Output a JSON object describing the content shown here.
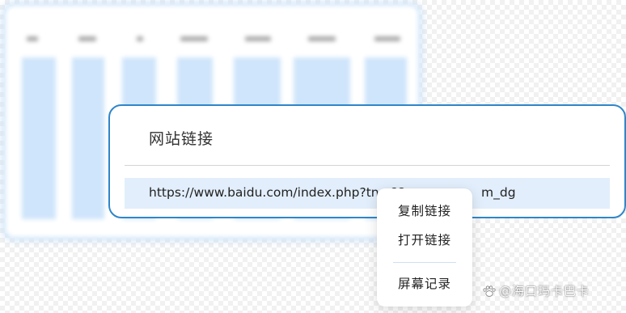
{
  "dialog": {
    "title": "网站链接",
    "url_visible": "https://www.baidu.com/index.php?tn=68",
    "url_visible_end": "m_dg"
  },
  "context_menu": {
    "items": [
      "复制链接",
      "打开链接",
      "屏幕记录"
    ]
  },
  "watermark": {
    "text": "@海口玛卡巴卡"
  },
  "colors": {
    "accent": "#2f86c9",
    "url_row_bg": "#e2eefb",
    "bg_bar": "#cfe5fb"
  }
}
